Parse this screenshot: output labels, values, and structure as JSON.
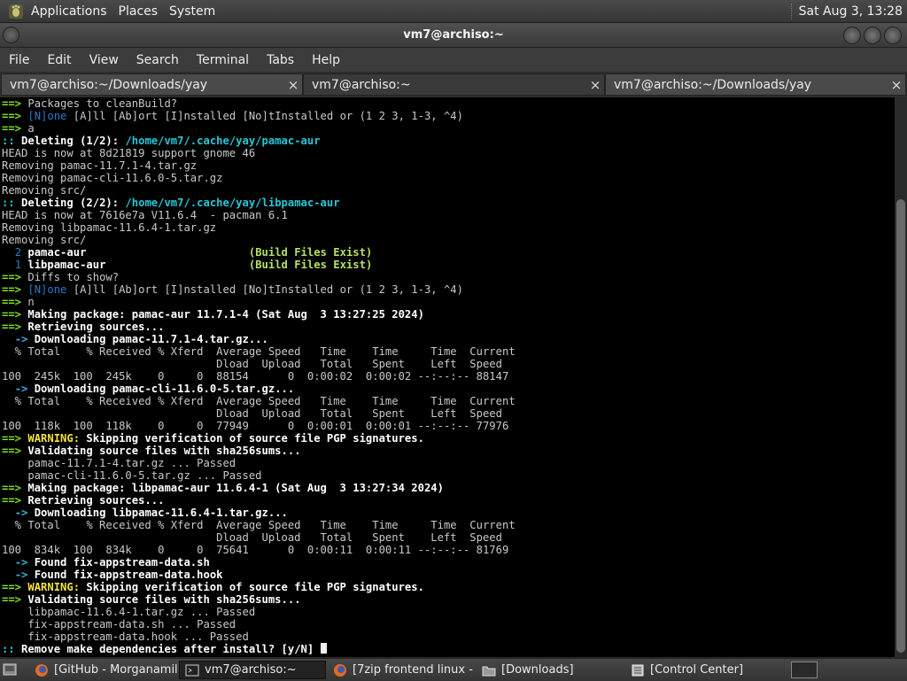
{
  "top_panel": {
    "menus": [
      "Applications",
      "Places",
      "System"
    ],
    "clock": "Sat Aug  3, 13:28"
  },
  "window": {
    "title": "vm7@archiso:~"
  },
  "menubar": [
    "File",
    "Edit",
    "View",
    "Search",
    "Terminal",
    "Tabs",
    "Help"
  ],
  "tabs": [
    {
      "label": "vm7@archiso:~/Downloads/yay",
      "close": "×"
    },
    {
      "label": "vm7@archiso:~",
      "close": "×"
    },
    {
      "label": "vm7@archiso:~/Downloads/yay",
      "close": "×"
    }
  ],
  "terminal": {
    "prompt_answer": "[y/N]",
    "lines": [
      "==> Packages to cleanBuild?",
      "==> [N]one [A]ll [Ab]ort [I]nstalled [No]tInstalled or (1 2 3, 1-3, ^4)",
      "==> a",
      ":: Deleting (1/2): /home/vm7/.cache/yay/pamac-aur",
      "HEAD is now at 8d21819 support gnome 46",
      "Removing pamac-11.7.1-4.tar.gz",
      "Removing pamac-cli-11.6.0-5.tar.gz",
      "Removing src/",
      ":: Deleting (2/2): /home/vm7/.cache/yay/libpamac-aur",
      "HEAD is now at 7616e7a V11.6.4  - pacman 6.1",
      "Removing libpamac-11.6.4-1.tar.gz",
      "Removing src/",
      "  2 pamac-aur                         (Build Files Exist)",
      "  1 libpamac-aur                      (Build Files Exist)",
      "==> Diffs to show?",
      "==> [N]one [A]ll [Ab]ort [I]nstalled [No]tInstalled or (1 2 3, 1-3, ^4)",
      "==> n",
      "==> Making package: pamac-aur 11.7.1-4 (Sat Aug  3 13:27:25 2024)",
      "==> Retrieving sources...",
      "  -> Downloading pamac-11.7.1-4.tar.gz...",
      "  % Total    % Received % Xferd  Average Speed   Time    Time     Time  Current",
      "                                 Dload  Upload   Total   Spent    Left  Speed",
      "100  245k  100  245k    0     0  88154      0  0:00:02  0:00:02 --:--:-- 88147",
      "  -> Downloading pamac-cli-11.6.0-5.tar.gz...",
      "  % Total    % Received % Xferd  Average Speed   Time    Time     Time  Current",
      "                                 Dload  Upload   Total   Spent    Left  Speed",
      "100  118k  100  118k    0     0  77949      0  0:00:01  0:00:01 --:--:-- 77976",
      "==> WARNING: Skipping verification of source file PGP signatures.",
      "==> Validating source files with sha256sums...",
      "    pamac-11.7.1-4.tar.gz ... Passed",
      "    pamac-cli-11.6.0-5.tar.gz ... Passed",
      "==> Making package: libpamac-aur 11.6.4-1 (Sat Aug  3 13:27:34 2024)",
      "==> Retrieving sources...",
      "  -> Downloading libpamac-11.6.4-1.tar.gz...",
      "  % Total    % Received % Xferd  Average Speed   Time    Time     Time  Current",
      "                                 Dload  Upload   Total   Spent    Left  Speed",
      "100  834k  100  834k    0     0  75641      0  0:00:11  0:00:11 --:--:-- 81769",
      "  -> Found fix-appstream-data.sh",
      "  -> Found fix-appstream-data.hook",
      "==> WARNING: Skipping verification of source file PGP signatures.",
      "==> Validating source files with sha256sums...",
      "    libpamac-11.6.4-1.tar.gz ... Passed",
      "    fix-appstream-data.sh ... Passed",
      "    fix-appstream-data.hook ... Passed",
      ":: Remove make dependencies after install? [y/N] "
    ]
  },
  "taskbar": {
    "items": [
      {
        "label": "[GitHub - Morganamil...",
        "icon": "firefox-icon",
        "active": false
      },
      {
        "label": "vm7@archiso:~",
        "icon": "terminal-icon",
        "active": true
      },
      {
        "label": "[7zip frontend linux - ...",
        "icon": "firefox-icon",
        "active": false
      },
      {
        "label": "[Downloads]",
        "icon": "folder-icon",
        "active": false
      },
      {
        "label": "[Control Center]",
        "icon": "control-center-icon",
        "active": false
      }
    ]
  },
  "colors": {
    "prompt_arrow": "#7fe01f",
    "path": "#3ab0e0",
    "warning": "#f2e33a",
    "terminal_bg": "#000000"
  }
}
